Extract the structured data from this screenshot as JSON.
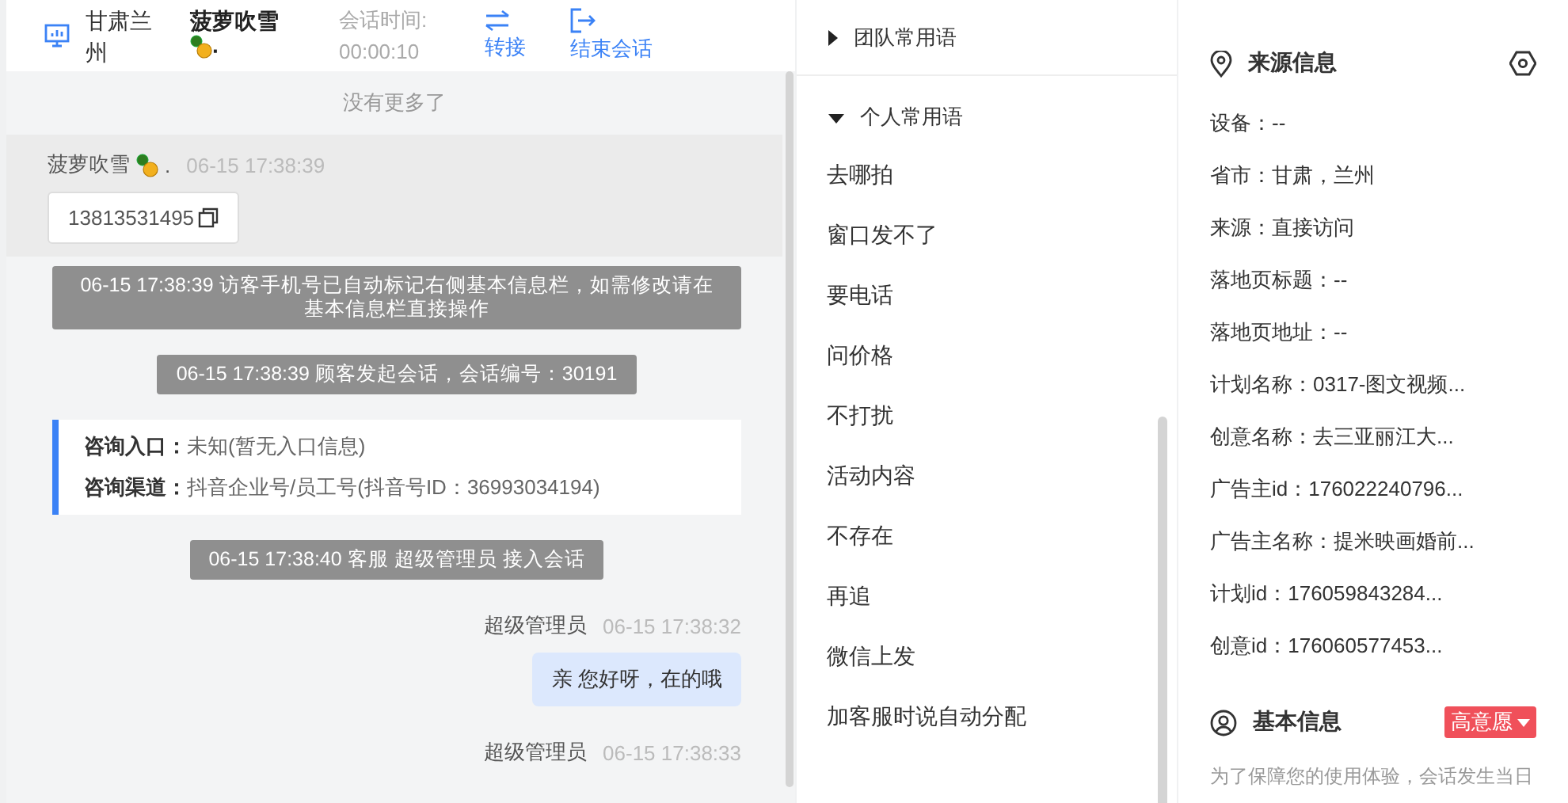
{
  "header": {
    "location": "甘肃兰州",
    "visitor": {
      "name": "菠萝吹雪",
      "suffix": "·"
    },
    "duration_label": "会话时间:",
    "duration": "00:00:10",
    "actions": [
      {
        "kind": "transfer",
        "label": "转接"
      },
      {
        "kind": "end",
        "label": "结束会话"
      }
    ]
  },
  "chat": {
    "no_more": "没有更多了",
    "messages": [
      {
        "kind": "visitor",
        "sender": "菠萝吹雪",
        "suffix": ".",
        "time": "06-15 17:38:39",
        "card": "13813531495"
      },
      {
        "kind": "system",
        "text": "06-15 17:38:39 访客手机号已自动标记右侧基本信息栏，如需修改请在基本信息栏直接操作"
      },
      {
        "kind": "system",
        "text": "06-15 17:38:39 顾客发起会话，会话编号：30191"
      },
      {
        "kind": "entry",
        "rows": [
          {
            "label": "咨询入口：",
            "value": "未知(暂无入口信息)"
          },
          {
            "label": "咨询渠道：",
            "value": "抖音企业号/员工号(抖音号ID：36993034194)"
          }
        ]
      },
      {
        "kind": "system",
        "text": "06-15 17:38:40 客服 超级管理员 接入会话"
      },
      {
        "kind": "agent",
        "sender": "超级管理员",
        "time": "06-15 17:38:32",
        "text": "亲 您好呀，在的哦"
      },
      {
        "kind": "agent",
        "sender": "超级管理员",
        "time": "06-15 17:38:33"
      }
    ]
  },
  "phrases": [
    {
      "title": "团队常用语",
      "expanded": false
    },
    {
      "title": "个人常用语",
      "expanded": true,
      "items": [
        "去哪拍",
        "窗口发不了",
        "要电话",
        "问价格",
        "不打扰",
        "活动内容",
        "不存在",
        "再追",
        "微信上发",
        "加客服时说自动分配"
      ]
    }
  ],
  "source_info": {
    "title": "来源信息",
    "fields": [
      "设备：--",
      "省市：甘肃，兰州",
      "来源：直接访问",
      "落地页标题：--",
      "落地页地址：--",
      "计划名称：0317-图文视频...",
      "创意名称：去三亚丽江大...",
      "广告主id：176022240796...",
      "广告主名称：提米映画婚前...",
      "计划id：176059843284...",
      "创意id：176060577453..."
    ]
  },
  "basic_info": {
    "title": "基本信息",
    "tag": "高意愿",
    "note": "为了保障您的使用体验，会话发生当日"
  }
}
